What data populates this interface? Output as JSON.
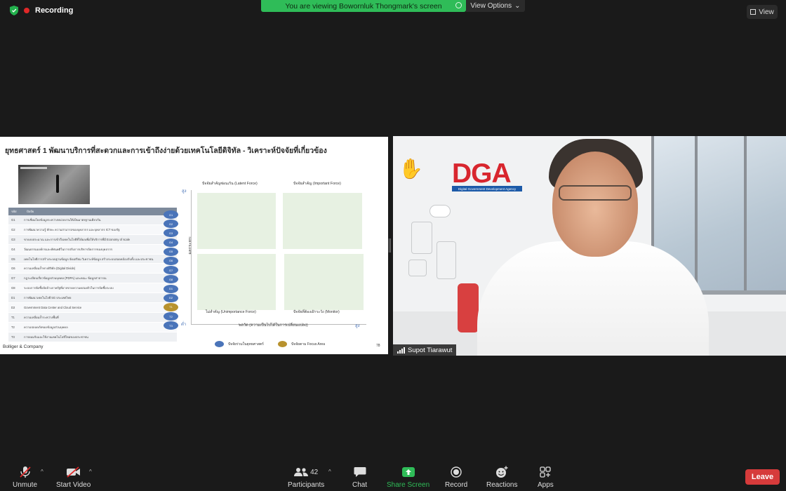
{
  "recording": {
    "label": "Recording"
  },
  "banner": {
    "text": "You are viewing Bowornluk Thongmark's screen",
    "view_options": "View Options"
  },
  "view_button": {
    "label": "View"
  },
  "slide": {
    "title": "ยุทธศาสตร์ 1 พัฒนาบริการที่สะดวกและการเข้าถึงง่ายด้วยเทคโนโลยีดิจิทัล - วิเคราะห์ปัจจัยที่เกี่ยวข้อง",
    "table_header": {
      "code": "รหัส",
      "factor": "ปัจจัย"
    },
    "factors": [
      {
        "code": "G1",
        "text": "การเชื่อมโยงข้อมูลระหว่างหน่วยงานให้เป็นมาตรฐานเดียวกัน"
      },
      {
        "code": "G2",
        "text": "การพัฒนาความรู้ ทักษะ ความสามารถของบุคลากร และบุคลากร ICT ของรัฐ"
      },
      {
        "code": "G3",
        "text": "ขาดงบประมาณ และการเข้าถึงเทคโนโลยีที่ได้ผลเพื่อให้บริการที่มี Economy of scale"
      },
      {
        "code": "G4",
        "text": "วัฒนธรรมองค์กรและทัศนคติในการปรับการบริหารจัดการของบุคลากร"
      },
      {
        "code": "G5",
        "text": "เทคโนโลยีการสร้างระบบฐานข้อมูล จัดเตรียม วิเคราะห์ข้อมูล สร้างระบบสอดคล้องกับทั้ง และประชาชน"
      },
      {
        "code": "G6",
        "text": "ความเหลื่อมล้ำทางดิจิทัล (Digital Divide)"
      },
      {
        "code": "G7",
        "text": "กฎระเบียบเกี่ยวข้อมูลส่วนบุคคล (PDPA) และคณะ ข้อมูลสาธารณ"
      },
      {
        "code": "G8",
        "text": "ระบบการจัดซื้อจัดจ้างภาครัฐที่อาจขาดความคล่องตัวในการจัดซื้อระบบ"
      },
      {
        "code": "D1",
        "text": "การพัฒนาเทคโนโลยี 5G ประเทศไทย"
      },
      {
        "code": "D2",
        "text": "Government Data Center and Cloud Service"
      },
      {
        "code": "T1",
        "text": "ความเหลื่อมล้ำระหว่างพื้นที่"
      },
      {
        "code": "T2",
        "text": "ความปลอดภัยของข้อมูลส่วนบุคคล"
      },
      {
        "code": "T3",
        "text": "การยอมรับและใช้งานเทคโนโลยีใหม่ของประชาชน"
      }
    ],
    "badges": [
      "G1",
      "G2",
      "G3",
      "G4",
      "G5",
      "G6",
      "G7",
      "G8",
      "D1",
      "D2",
      "T1",
      "T2",
      "T3"
    ],
    "quadrants": {
      "top_left": "ปัจจัยสำคัญซ่อนเร้น (Latent Force)",
      "top_right": "ปัจจัยสำคัญ (Important Force)",
      "bottom_left": "ไม่สำคัญ (Unimportance Force)",
      "bottom_right": "ปัจจัยที่ต้องเฝ้าระวัง (Monitor)"
    },
    "y_axis_label": "ผลกระทบ",
    "y_high": "สูง",
    "y_low": "ต่ำ",
    "x_axis_label": "พลวัต (ความเป็นไปได้ในการเปลี่ยนแปลง)",
    "x_high": "สูง",
    "legend": [
      {
        "label": "ปัจจัยร่วมในยุทธศาสตร์",
        "color": "#4a74b9"
      },
      {
        "label": "ปัจจัยตาม Focus Area",
        "color": "#b8922e"
      }
    ],
    "brand": "Bolliger & Company",
    "page_number": "78"
  },
  "camera": {
    "logo": "DGA",
    "logo_sub": "Digital Government Development Agency",
    "hand": "✋",
    "participant_name": "Supot Tiarawut"
  },
  "toolbar": {
    "unmute": "Unmute",
    "start_video": "Start Video",
    "participants": "Participants",
    "participants_count": "42",
    "chat": "Chat",
    "share_screen": "Share Screen",
    "record": "Record",
    "reactions": "Reactions",
    "apps": "Apps",
    "leave": "Leave",
    "share_color": "#2fbc58",
    "leave_color": "#d63b3b"
  }
}
